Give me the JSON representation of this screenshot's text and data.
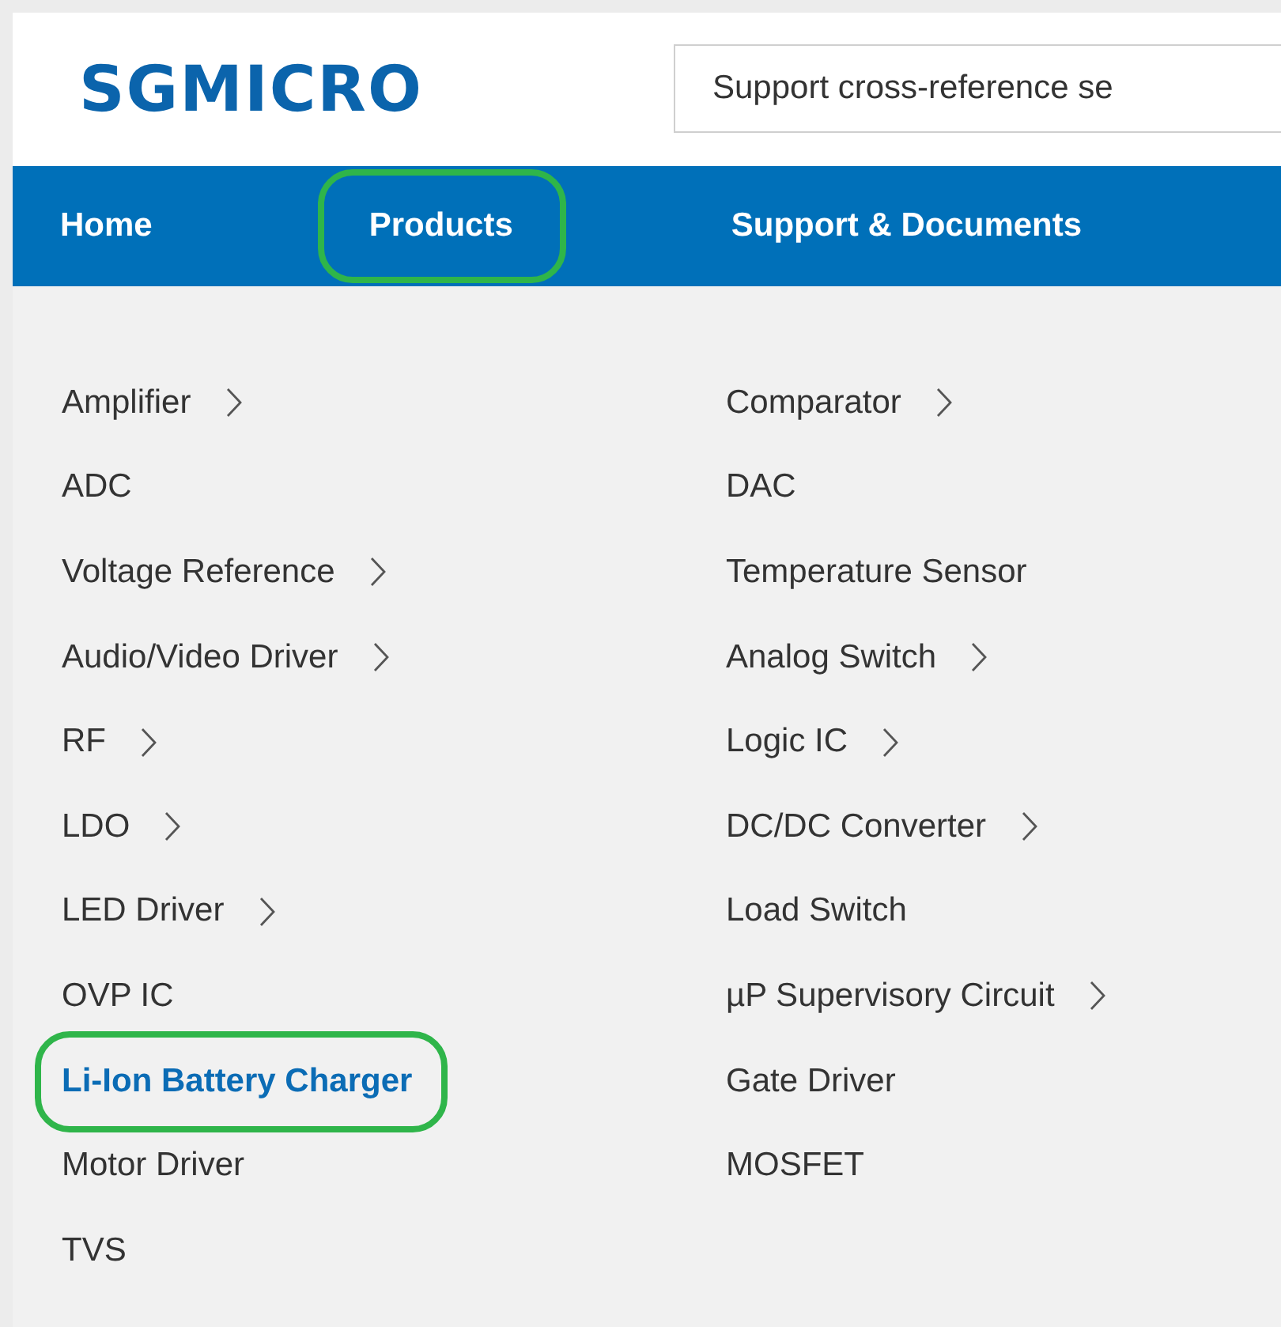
{
  "header": {
    "logo": "SGMICRO",
    "search": {
      "placeholder": "Support cross-reference se"
    }
  },
  "nav": [
    {
      "label": "Home",
      "circled": false
    },
    {
      "label": "Products",
      "circled": true
    },
    {
      "label": "Support & Documents",
      "circled": false
    }
  ],
  "menu": {
    "columns": [
      [
        {
          "label": "Amplifier",
          "submenu": true,
          "selected": false,
          "circled": false
        },
        {
          "label": "ADC",
          "submenu": false,
          "selected": false,
          "circled": false
        },
        {
          "label": "Voltage Reference",
          "submenu": true,
          "selected": false,
          "circled": false
        },
        {
          "label": "Audio/Video Driver",
          "submenu": true,
          "selected": false,
          "circled": false
        },
        {
          "label": "RF",
          "submenu": true,
          "selected": false,
          "circled": false
        },
        {
          "label": "LDO",
          "submenu": true,
          "selected": false,
          "circled": false
        },
        {
          "label": "LED Driver",
          "submenu": true,
          "selected": false,
          "circled": false
        },
        {
          "label": "OVP IC",
          "submenu": false,
          "selected": false,
          "circled": false
        },
        {
          "label": "Li-Ion Battery Charger",
          "submenu": false,
          "selected": true,
          "circled": true
        },
        {
          "label": "Motor Driver",
          "submenu": false,
          "selected": false,
          "circled": false
        },
        {
          "label": "TVS",
          "submenu": false,
          "selected": false,
          "circled": false
        }
      ],
      [
        {
          "label": "Comparator",
          "submenu": true,
          "selected": false,
          "circled": false
        },
        {
          "label": "DAC",
          "submenu": false,
          "selected": false,
          "circled": false
        },
        {
          "label": "Temperature Sensor",
          "submenu": false,
          "selected": false,
          "circled": false
        },
        {
          "label": "Analog Switch",
          "submenu": true,
          "selected": false,
          "circled": false
        },
        {
          "label": "Logic IC",
          "submenu": true,
          "selected": false,
          "circled": false
        },
        {
          "label": "DC/DC Converter",
          "submenu": true,
          "selected": false,
          "circled": false
        },
        {
          "label": "Load Switch",
          "submenu": false,
          "selected": false,
          "circled": false
        },
        {
          "label": "µP Supervisory Circuit",
          "submenu": true,
          "selected": false,
          "circled": false
        },
        {
          "label": "Gate Driver",
          "submenu": false,
          "selected": false,
          "circled": false
        },
        {
          "label": "MOSFET",
          "submenu": false,
          "selected": false,
          "circled": false
        }
      ]
    ]
  }
}
